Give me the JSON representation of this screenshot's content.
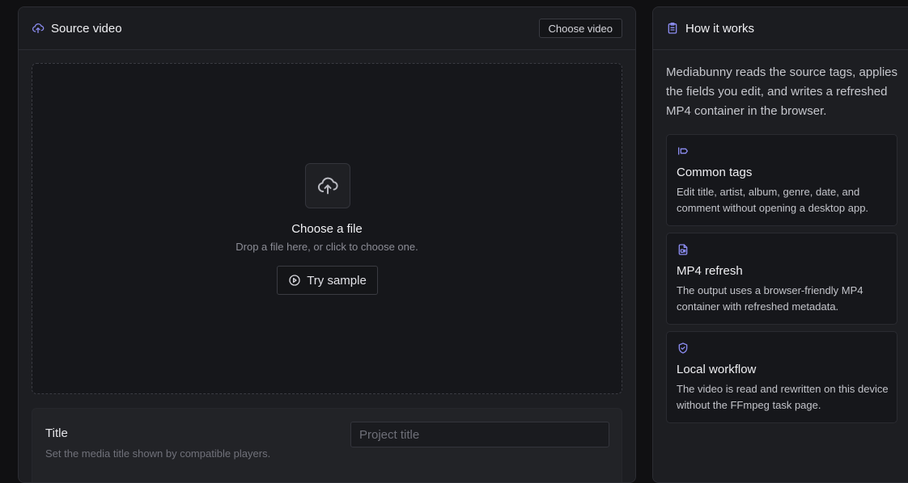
{
  "source": {
    "header_title": "Source video",
    "choose_video_label": "Choose video",
    "dropzone_title": "Choose a file",
    "dropzone_subtitle": "Drop a file here, or click to choose one.",
    "try_sample_label": "Try sample"
  },
  "title_field": {
    "label": "Title",
    "hint": "Set the media title shown by compatible players.",
    "placeholder": "Project title",
    "value": ""
  },
  "how_it_works": {
    "header_title": "How it works",
    "intro": "Mediabunny reads the source tags, applies the fields you edit, and writes a refreshed MP4 container in the browser.",
    "features": [
      {
        "icon": "tag-icon",
        "title": "Common tags",
        "description": "Edit title, artist, album, genre, date, and comment without opening a desktop app."
      },
      {
        "icon": "file-video-icon",
        "title": "MP4 refresh",
        "description": "The output uses a browser-friendly MP4 container with refreshed metadata."
      },
      {
        "icon": "shield-check-icon",
        "title": "Local workflow",
        "description": "The video is read and rewritten on this device without the FFmpeg task page."
      }
    ]
  },
  "colors": {
    "accent_icon": "#8b8cf0",
    "background": "#101012",
    "panel": "#1b1c20"
  }
}
